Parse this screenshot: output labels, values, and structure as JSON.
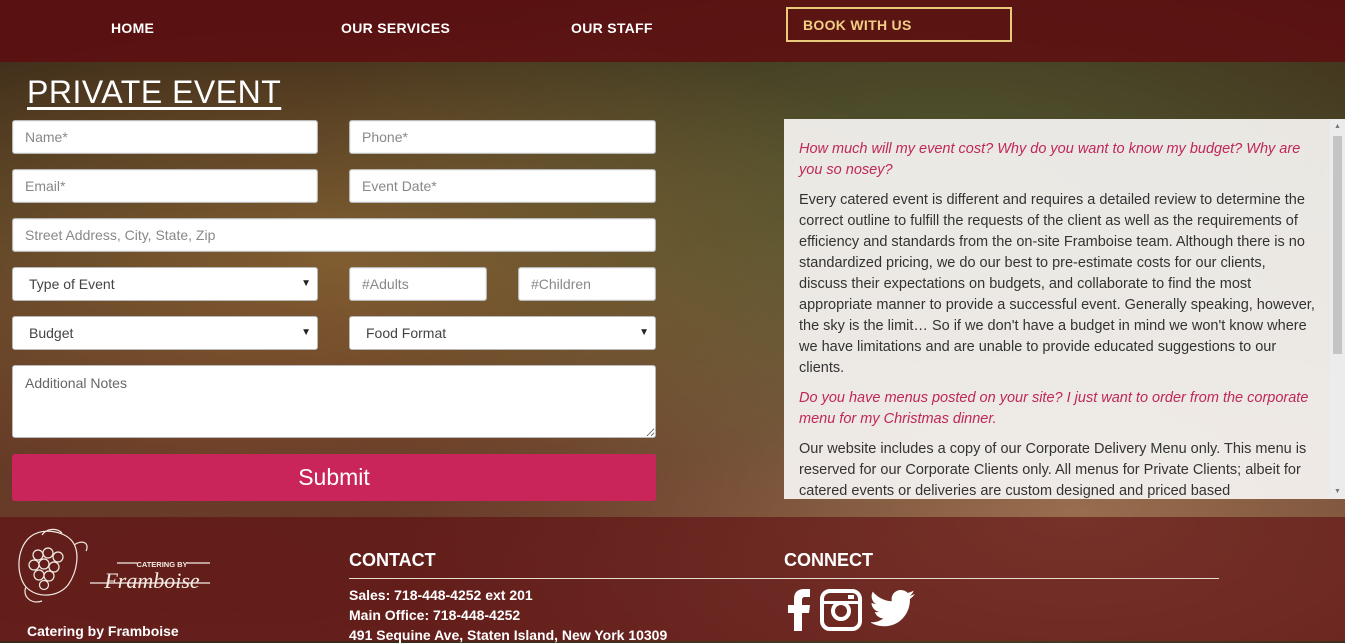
{
  "nav": {
    "home": "HOME",
    "services": "OUR SERVICES",
    "staff": "OUR STAFF",
    "book": "BOOK WITH US"
  },
  "page_title": "PRIVATE EVENT",
  "form": {
    "name_placeholder": "Name*",
    "phone_placeholder": "Phone*",
    "email_placeholder": "Email*",
    "event_date_placeholder": "Event Date*",
    "address_placeholder": "Street Address, City, State, Zip",
    "event_type_selected": "Type of Event",
    "adults_placeholder": "#Adults",
    "children_placeholder": "#Children",
    "budget_selected": "Budget",
    "food_format_selected": "Food Format",
    "notes_placeholder": "Additional Notes",
    "submit_label": "Submit"
  },
  "faq": {
    "q1": "How much will my event cost? Why do you want to know my budget? Why are you so nosey?",
    "a1": "Every catered event is different and requires a detailed review to determine the correct outline to fulfill the requests of the client as well as the requirements of efficiency and standards from the on-site Framboise team. Although there is no standardized pricing, we do our best to pre-estimate costs for our clients, discuss their expectations on budgets, and collaborate to find the most appropriate manner to provide a successful event. Generally speaking, however, the sky is the limit… So if we don't have a budget in mind we won't know where we have limitations and are unable to provide educated suggestions to our clients.",
    "q2": "Do you have menus posted on your site? I just want to order from the corporate menu for my Christmas dinner.",
    "a2": "Our website includes a copy of our Corporate Delivery Menu only. This menu is reserved for our Corporate Clients only. All menus for Private Clients; albeit for catered events or deliveries are custom designed and priced based"
  },
  "footer": {
    "logo_small_text": "CATERING BY",
    "logo_script_text": "Framboise",
    "brand_name": "Catering by Framboise",
    "contact_heading": "CONTACT",
    "connect_heading": "CONNECT",
    "sales": "Sales: 718-448-4252 ext 201",
    "main_office": "Main Office: 718-448-4252",
    "address": "491 Sequine Ave, Staten Island, New York 10309"
  },
  "social_icons": [
    "facebook-icon",
    "instagram-icon",
    "twitter-icon"
  ],
  "colors": {
    "nav_bg": "#5f0c10",
    "accent": "#c9255a",
    "book_border": "#e9c97a",
    "faq_question": "#c0275a"
  }
}
